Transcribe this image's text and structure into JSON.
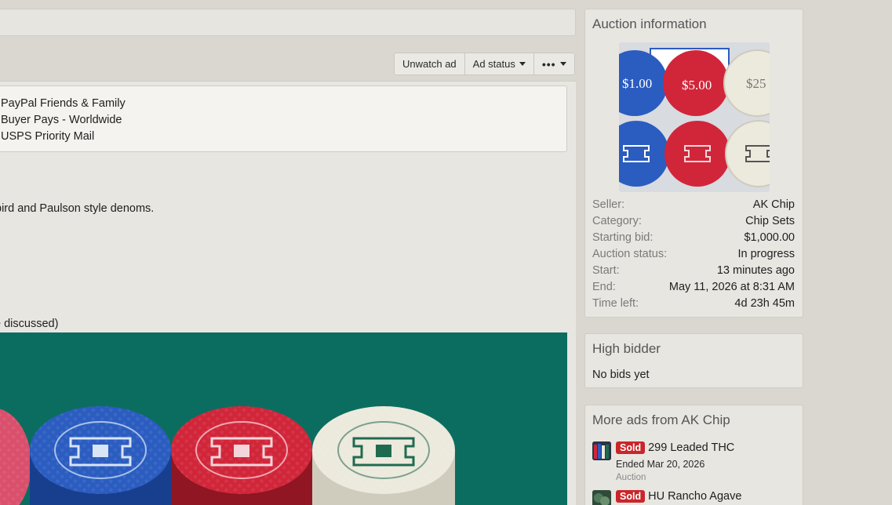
{
  "toolbar": {
    "unwatch_label": "Unwatch ad",
    "ad_status_label": "Ad status",
    "more_label": "•••"
  },
  "shipping": {
    "payment": "PayPal Friends & Family",
    "shipping_cost": "Buyer Pays - Worldwide",
    "carrier": "USPS Priority Mail"
  },
  "description": {
    "line1": "bird and Paulson style denoms.",
    "line2": "e discussed)"
  },
  "auction_info": {
    "title": "Auction information",
    "thumb_chip_labels": [
      "$1.00",
      "$5.00",
      "$25"
    ],
    "rows": [
      {
        "key": "Seller:",
        "value": "AK Chip"
      },
      {
        "key": "Category:",
        "value": "Chip Sets"
      },
      {
        "key": "Starting bid:",
        "value": "$1,000.00"
      },
      {
        "key": "Auction status:",
        "value": "In progress"
      },
      {
        "key": "Start:",
        "value": "13 minutes ago"
      },
      {
        "key": "End:",
        "value": "May 11, 2026 at 8:31 AM"
      },
      {
        "key": "Time left:",
        "value": "4d 23h 45m"
      }
    ]
  },
  "high_bidder": {
    "title": "High bidder",
    "value": "No bids yet"
  },
  "more_ads": {
    "title": "More ads from AK Chip",
    "items": [
      {
        "badge": "Sold",
        "title": "299 Leaded THC",
        "ended": "Ended Mar 20, 2026",
        "type": "Auction"
      },
      {
        "badge": "Sold",
        "title": "HU Rancho Agave"
      }
    ]
  },
  "colors": {
    "sold_badge": "#c8262b",
    "felt": "#0b6d60"
  }
}
